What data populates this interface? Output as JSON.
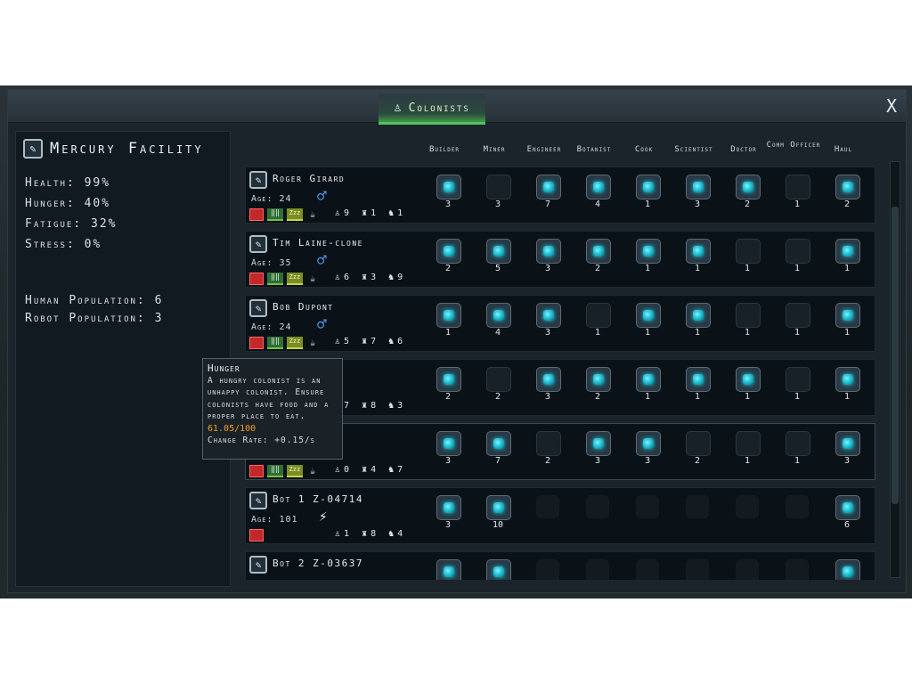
{
  "window": {
    "title": "Colonists",
    "close_label": "X"
  },
  "facility": {
    "name": "Mercury Facility"
  },
  "stats": {
    "health": "Health: 99%",
    "hunger": "Hunger: 40%",
    "fatigue": "Fatigue: 32%",
    "stress": "Stress: 0%",
    "human_population": "Human Population: 6",
    "robot_population": "Robot Population: 3"
  },
  "jobs": [
    "Builder",
    "Miner",
    "Engineer",
    "Botanist",
    "Cook",
    "Scientist",
    "Doctor",
    "Comm Officer",
    "Haul"
  ],
  "colonists": [
    {
      "name": "Roger Girard",
      "age": "Age: 24",
      "gender": "♂",
      "type": "human",
      "c1": "9",
      "c2": "1",
      "c3": "1",
      "cells": [
        "on",
        "off",
        "on",
        "on",
        "on",
        "on",
        "on",
        "off",
        "on"
      ],
      "values": [
        "3",
        "3",
        "7",
        "4",
        "1",
        "3",
        "2",
        "1",
        "2"
      ]
    },
    {
      "name": "Tim Laine-clone",
      "age": "Age: 35",
      "gender": "♂",
      "type": "human",
      "c1": "6",
      "c2": "3",
      "c3": "9",
      "cells": [
        "on",
        "on",
        "on",
        "on",
        "on",
        "on",
        "off",
        "off",
        "on"
      ],
      "values": [
        "2",
        "5",
        "3",
        "2",
        "1",
        "1",
        "1",
        "1",
        "1"
      ]
    },
    {
      "name": "Bob Dupont",
      "age": "Age: 24",
      "gender": "♂",
      "type": "human",
      "c1": "5",
      "c2": "7",
      "c3": "6",
      "cells": [
        "on",
        "on",
        "on",
        "off",
        "on",
        "on",
        "off",
        "off",
        "on"
      ],
      "values": [
        "1",
        "4",
        "3",
        "1",
        "1",
        "1",
        "1",
        "1",
        "1"
      ]
    },
    {
      "name": "",
      "age": "",
      "gender": "",
      "type": "human",
      "c1": "7",
      "c2": "8",
      "c3": "3",
      "cells": [
        "on",
        "off",
        "on",
        "on",
        "on",
        "on",
        "on",
        "off",
        "on"
      ],
      "values": [
        "2",
        "2",
        "3",
        "2",
        "1",
        "1",
        "1",
        "1",
        "1"
      ]
    },
    {
      "name": "",
      "age": "",
      "gender": "",
      "type": "human",
      "c1": "0",
      "c2": "4",
      "c3": "7",
      "cells": [
        "on",
        "on",
        "off",
        "on",
        "on",
        "off",
        "off",
        "off",
        "on"
      ],
      "values": [
        "3",
        "7",
        "2",
        "3",
        "3",
        "2",
        "1",
        "1",
        "3"
      ]
    },
    {
      "name": "Bot 1 Z-04714",
      "age": "Age: 101",
      "gender": "⚡",
      "type": "robot",
      "c1": "1",
      "c2": "8",
      "c3": "4",
      "cells": [
        "on",
        "on",
        "dim",
        "dim",
        "dim",
        "dim",
        "dim",
        "dim",
        "on"
      ],
      "values": [
        "3",
        "10",
        "",
        "",
        "",
        "",
        "",
        "",
        "6"
      ]
    },
    {
      "name": "Bot 2  Z-03637",
      "age": "",
      "gender": "",
      "type": "robot",
      "c1": "",
      "c2": "",
      "c3": "",
      "cells": [
        "on",
        "on",
        "dim",
        "dim",
        "dim",
        "dim",
        "dim",
        "dim",
        "on"
      ],
      "values": [
        "",
        "",
        "",
        "",
        "",
        "",
        "",
        "",
        ""
      ]
    }
  ],
  "tooltip": {
    "title": "Hunger",
    "description": "A hungry colonist is an unhappy colonist. Ensure colonists have food and a proper place to eat.",
    "value": "61.05/100",
    "rate": "Change Rate: +0.15/s"
  },
  "icon_labels": {
    "sleep": "Zzz",
    "food": "‖‖"
  },
  "colors": {
    "accent": "#52c060",
    "crystal": "#17b5c8",
    "tooltip_value": "#f0a020",
    "male": "#4a9cf0"
  }
}
